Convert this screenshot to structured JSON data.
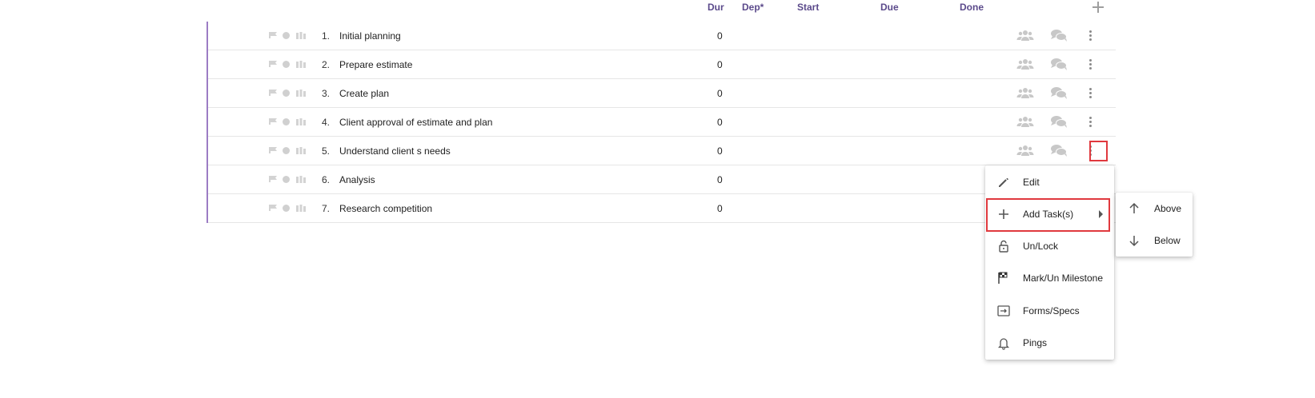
{
  "columns": {
    "dur": "Dur",
    "dep": "Dep*",
    "start": "Start",
    "due": "Due",
    "done": "Done"
  },
  "tasks": [
    {
      "num": "1.",
      "name": "Initial planning",
      "dur": "0"
    },
    {
      "num": "2.",
      "name": "Prepare estimate",
      "dur": "0"
    },
    {
      "num": "3.",
      "name": "Create plan",
      "dur": "0"
    },
    {
      "num": "4.",
      "name": "Client approval of estimate and plan",
      "dur": "0"
    },
    {
      "num": "5.",
      "name": "Understand client s needs",
      "dur": "0"
    },
    {
      "num": "6.",
      "name": "Analysis",
      "dur": "0"
    },
    {
      "num": "7.",
      "name": "Research competition",
      "dur": "0"
    }
  ],
  "context_menu": {
    "edit": "Edit",
    "add_tasks": "Add Task(s)",
    "unlock": "Un/Lock",
    "milestone": "Mark/Un Milestone",
    "forms": "Forms/Specs",
    "pings": "Pings"
  },
  "submenu": {
    "above": "Above",
    "below": "Below"
  },
  "colors": {
    "accent": "#5b4a8b",
    "row_border": "#9c7cc4",
    "highlight": "#e0393e"
  }
}
